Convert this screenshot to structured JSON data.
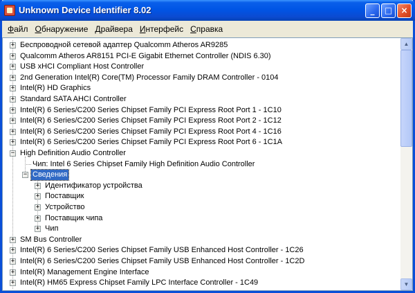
{
  "window": {
    "title": "Unknown Device Identifier 8.02"
  },
  "title_buttons": {
    "minimize": "_",
    "maximize": "□",
    "close": "×"
  },
  "menu": [
    {
      "first": "Ф",
      "rest": "айл"
    },
    {
      "first": "О",
      "rest": "бнаружение"
    },
    {
      "first": "Д",
      "rest": "райвера"
    },
    {
      "first": "И",
      "rest": "нтерфейс"
    },
    {
      "first": "С",
      "rest": "правка"
    }
  ],
  "tree": {
    "top_items": [
      "Беспроводной сетевой адаптер Qualcomm Atheros AR9285",
      "Qualcomm Atheros AR8151 PCI-E Gigabit Ethernet Controller (NDIS 6.30)",
      "USB xHCI Compliant Host Controller",
      "2nd Generation Intel(R) Core(TM) Processor Family DRAM Controller - 0104",
      "Intel(R) HD Graphics",
      "Standard SATA AHCI Controller",
      "Intel(R) 6 Series/C200 Series Chipset Family PCI Express Root Port 1 - 1C10",
      "Intel(R) 6 Series/C200 Series Chipset Family PCI Express Root Port 2 - 1C12",
      "Intel(R) 6 Series/C200 Series Chipset Family PCI Express Root Port 4 - 1C16",
      "Intel(R) 6 Series/C200 Series Chipset Family PCI Express Root Port 6 - 1C1A"
    ],
    "expanded_item": "High Definition Audio Controller",
    "chip_line": "Чип: Intel  6 Series Chipset Family High Definition Audio Controller",
    "details_node": "Сведения",
    "details_children": [
      "Идентификатор устройства",
      "Поставщик",
      "Устройство",
      "Поставщик чипа",
      "Чип"
    ],
    "bottom_items": [
      "SM Bus Controller",
      "Intel(R) 6 Series/C200 Series Chipset Family USB Enhanced Host Controller - 1C26",
      "Intel(R) 6 Series/C200 Series Chipset Family USB Enhanced Host Controller - 1C2D",
      "Intel(R) Management Engine Interface",
      "Intel(R) HM65 Express Chipset Family LPC Interface Controller - 1C49"
    ],
    "expand_glyph": "+",
    "collapse_glyph": "−"
  },
  "scrollbar": {
    "up": "▲",
    "down": "▼"
  },
  "colors": {
    "titlebar": "#0055e5",
    "selection": "#316ac5",
    "window_bg": "#ece9d8"
  }
}
